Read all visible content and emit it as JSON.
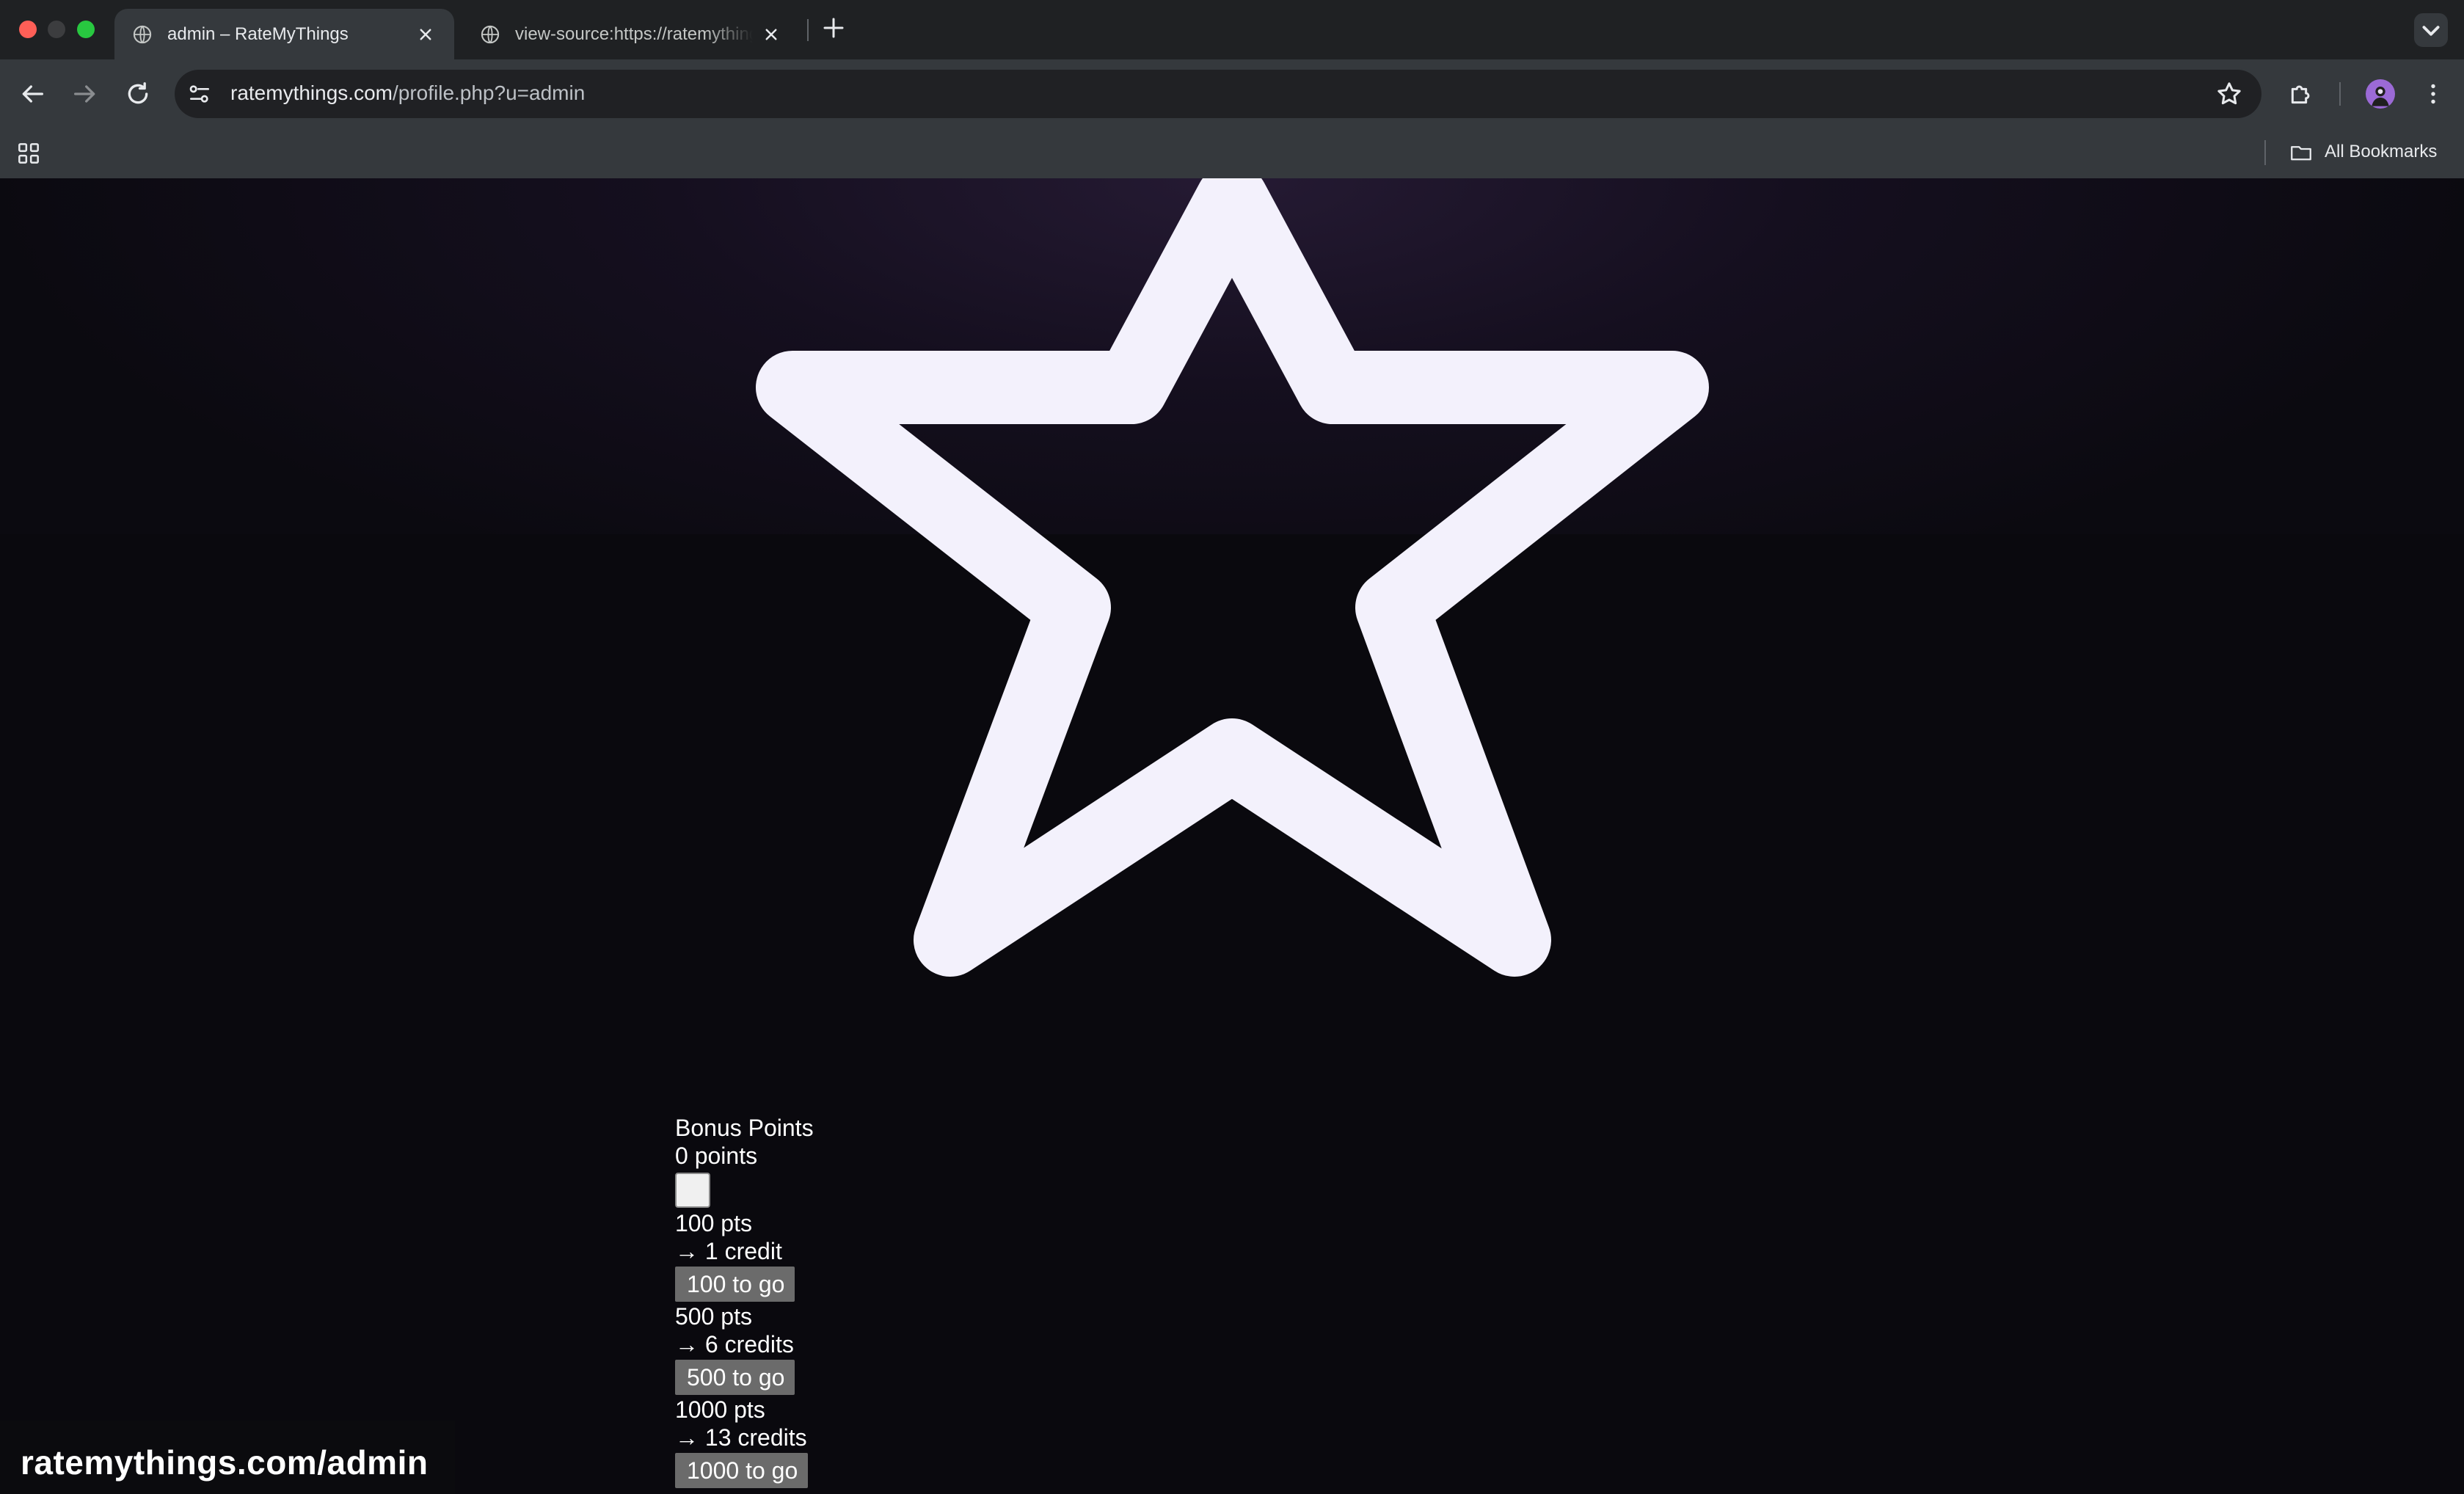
{
  "browser": {
    "tabs": [
      {
        "title": "admin – RateMyThings",
        "active": true
      },
      {
        "title": "view-source:https://ratemythings.com/profile.php?u=admin",
        "active": false
      }
    ],
    "url_domain": "ratemythings.com",
    "url_path": "/profile.php?u=admin",
    "bookmarks_label": "All Bookmarks"
  },
  "page": {
    "hero_icon": "star-outline-icon",
    "hero_star_color": "#f3f1fc",
    "bonus": {
      "heading": "Bonus Points",
      "points": "0 points",
      "tiers": [
        {
          "pts": "100 pts",
          "reward": "→ 1 credit",
          "button": "100 to go"
        },
        {
          "pts": "500 pts",
          "reward": "→ 6 credits",
          "button": "500 to go"
        },
        {
          "pts": "1000 pts",
          "reward": "→ 13 credits",
          "button": "1000 to go"
        }
      ]
    }
  },
  "watermark": "ratemythings.com/admin",
  "colors": {
    "page_bg": "#0a090e",
    "chrome_dark": "#1f2123",
    "chrome_toolbar": "#35393d",
    "button_bg": "#6b6b6b"
  }
}
